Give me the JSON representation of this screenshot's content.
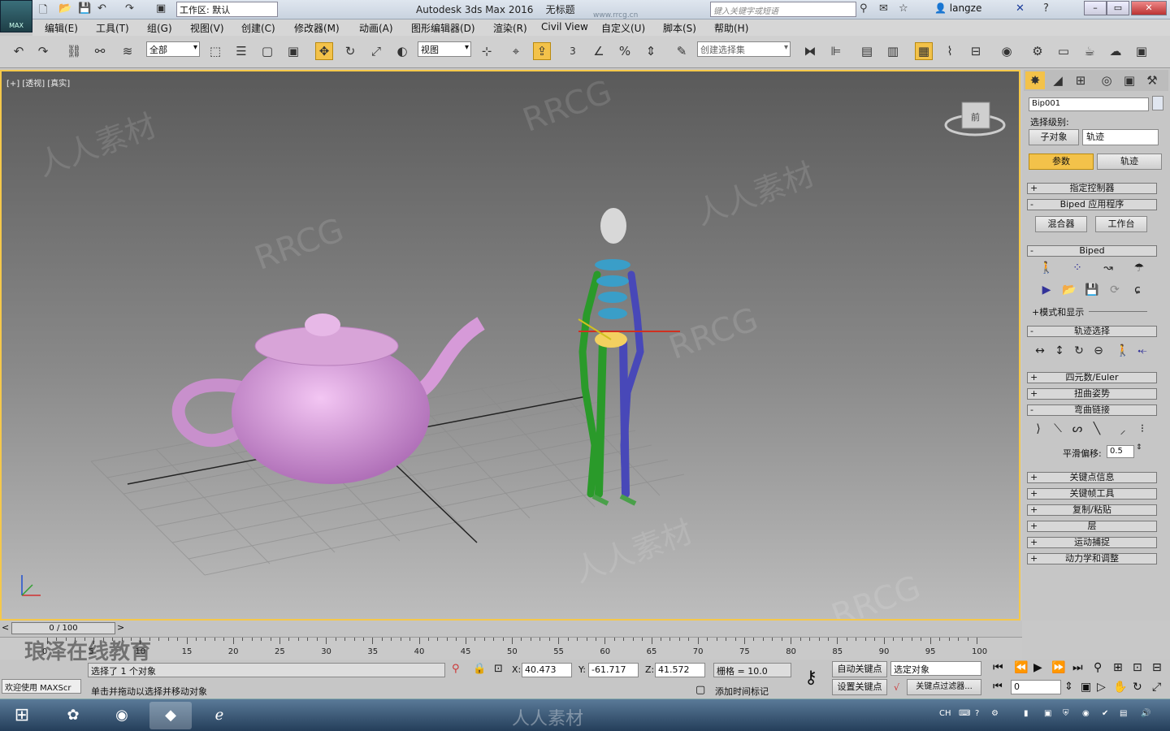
{
  "app": {
    "title": "Autodesk 3ds Max 2016",
    "doc": "无标题",
    "logo": "MAX",
    "workspace": "工作区: 默认",
    "search_placeholder": "键入关键字或短语",
    "user": "langze",
    "url_mark": "www.rrcg.cn"
  },
  "menu": [
    "编辑(E)",
    "工具(T)",
    "组(G)",
    "视图(V)",
    "创建(C)",
    "修改器(M)",
    "动画(A)",
    "图形编辑器(D)",
    "渲染(R)",
    "Civil View",
    "自定义(U)",
    "脚本(S)",
    "帮助(H)"
  ],
  "toolbar": {
    "filter": "全部",
    "refcoord": "视图",
    "selset": "创建选择集",
    "snap_label": "3"
  },
  "viewport": {
    "label": "[+] [透视] [真实]",
    "nav_cube": "前"
  },
  "panel": {
    "name": "Bip001",
    "sel_level": "选择级别:",
    "sub_obj": "子对象",
    "track_dd": "轨迹",
    "tab_params": "参数",
    "tab_track": "轨迹",
    "r1": "指定控制器",
    "r2": "Biped 应用程序",
    "mixer": "混合器",
    "workbench": "工作台",
    "biped": "Biped",
    "modes": "+模式和显示",
    "tracksel": "轨迹选择",
    "r3": "四元数/Euler",
    "r4": "扭曲姿势",
    "r5": "弯曲链接",
    "smooth": "平滑偏移:",
    "smooth_val": "0.5",
    "r6": "关键点信息",
    "r7": "关键帧工具",
    "r8": "复制/粘贴",
    "r9": "层",
    "r10": "运动捕捉",
    "r11": "动力学和调整"
  },
  "time": {
    "frame": "0 / 100",
    "ticks": [
      "0",
      "5",
      "10",
      "15",
      "20",
      "25",
      "30",
      "35",
      "40",
      "45",
      "50",
      "55",
      "60",
      "65",
      "70",
      "75",
      "80",
      "85",
      "90",
      "95",
      "100"
    ]
  },
  "status": {
    "selected": "选择了 1 个对象",
    "hint": "单击并拖动以选择并移动对象",
    "welcome": "欢迎使用 MAXScr",
    "x": "40.473",
    "y": "-61.717",
    "z": "41.572",
    "grid": "栅格 = 10.0",
    "autokey": "自动关键点",
    "setkey": "设置关键点",
    "seldd": "选定对象",
    "filters": "关键点过滤器...",
    "addtime": "添加时间标记",
    "frame": "0"
  },
  "taskbar": {
    "lang": "CH"
  },
  "watermark": {
    "cn": "人人素材",
    "en": "RRCG",
    "brand": "琅泽在线教育"
  }
}
